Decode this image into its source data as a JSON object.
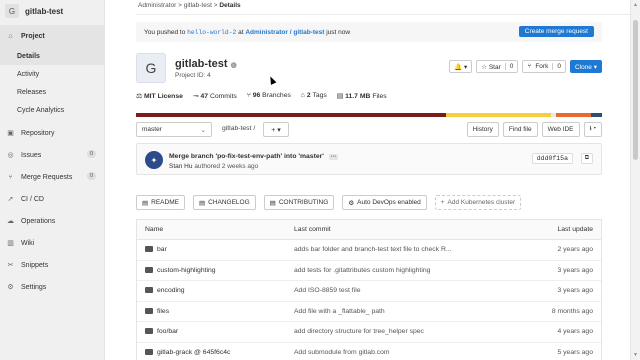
{
  "project": {
    "avatar_letter": "G",
    "name": "gitlab-test",
    "id_label": "Project ID: 4"
  },
  "sidebar": {
    "project_label": "Project",
    "sub_items": [
      {
        "label": "Details"
      },
      {
        "label": "Activity"
      },
      {
        "label": "Releases"
      },
      {
        "label": "Cycle Analytics"
      }
    ],
    "items": [
      {
        "label": "Repository",
        "count": ""
      },
      {
        "label": "Issues",
        "count": "0"
      },
      {
        "label": "Merge Requests",
        "count": "0"
      },
      {
        "label": "CI / CD",
        "count": ""
      },
      {
        "label": "Operations",
        "count": ""
      },
      {
        "label": "Wiki",
        "count": ""
      },
      {
        "label": "Snippets",
        "count": ""
      },
      {
        "label": "Settings",
        "count": ""
      }
    ]
  },
  "breadcrumb": {
    "a": "Administrator",
    "b": "gitlab-test",
    "c": "Details",
    "sep": ">"
  },
  "banner": {
    "prefix": "You pushed to",
    "branch": "hello-world-2",
    "at": "at",
    "repo": "Administrator / gitlab-test",
    "suffix": "just now",
    "button": "Create merge request"
  },
  "actions": {
    "notif": "🔔 ▾",
    "star": "☆ Star",
    "star_count": "0",
    "fork": "Fork",
    "fork_count": "0",
    "clone": "Clone ▾"
  },
  "stats": {
    "license": "MIT License",
    "commits_n": "47",
    "commits_l": "Commits",
    "branches_n": "96",
    "branches_l": "Branches",
    "tags_n": "2",
    "tags_l": "Tags",
    "size_n": "11.7 MB",
    "size_l": "Files"
  },
  "lang_colors": [
    "#7a1c1c",
    "#f4d03f",
    "#e9e9e9",
    "#e86a2e",
    "#2f4f6f"
  ],
  "toolbar": {
    "branch": "master",
    "path": "gitlab-test",
    "slash": "/",
    "plus": "+ ▾",
    "history": "History",
    "find": "Find file",
    "webide": "Web IDE",
    "download": "⭳ ▾"
  },
  "commit": {
    "title": "Merge branch 'po-fix-test-env-path' into 'master'",
    "dots": "···",
    "author": "Stan Hu",
    "authored": "authored 2 weeks ago",
    "sha": "ddd0f15a",
    "copy": "⧉"
  },
  "quick": [
    {
      "icon": "▤",
      "label": "README"
    },
    {
      "icon": "▤",
      "label": "CHANGELOG"
    },
    {
      "icon": "▤",
      "label": "CONTRIBUTING"
    },
    {
      "icon": "⚙",
      "label": "Auto DevOps enabled"
    },
    {
      "icon": "+",
      "label": "Add Kubernetes cluster"
    }
  ],
  "tree": {
    "headers": {
      "name": "Name",
      "commit": "Last commit",
      "update": "Last update"
    },
    "rows": [
      {
        "name": "bar",
        "commit": "adds bar folder and branch-test text file to check R...",
        "update": "2 years ago"
      },
      {
        "name": "custom-highlighting",
        "commit": "add tests for .gitattributes custom highlighting",
        "update": "3 years ago"
      },
      {
        "name": "encoding",
        "commit": "Add ISO-8859 test file",
        "update": "3 years ago"
      },
      {
        "name": "files",
        "commit": "Add file with a _flattable_ path",
        "update": "8 months ago"
      },
      {
        "name": "foo/bar",
        "commit": "add directory structure for tree_helper spec",
        "update": "4 years ago"
      },
      {
        "name": "gitlab-grack @ 645f6c4c",
        "commit": "Add submodule from gitlab.com",
        "update": "5 years ago"
      }
    ]
  }
}
